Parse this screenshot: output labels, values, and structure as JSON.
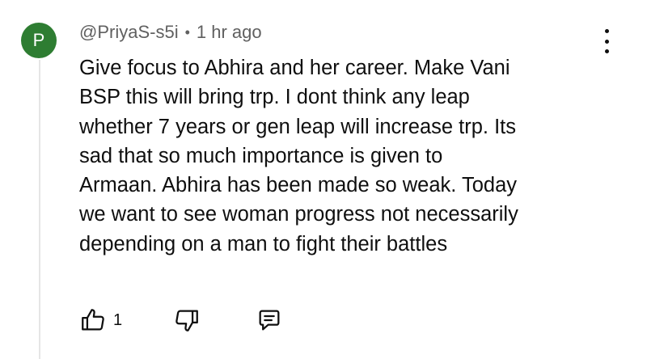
{
  "comment": {
    "avatar_letter": "P",
    "avatar_color": "#2e7d32",
    "author": "@PriyaS-s5i",
    "separator": "•",
    "timestamp": "1 hr ago",
    "text_lines": [
      "Give focus to Abhira and her career. Make Vani",
      "BSP this will bring trp. I dont think any leap",
      "whether 7 years or gen leap will increase trp. Its",
      "sad that so much importance is given to",
      "Armaan. Abhira has been made so weak. Today",
      "we want to see woman progress not necessarily",
      "depending on a man to fight their battles"
    ],
    "like_count": "1"
  },
  "icons": {
    "like": "thumbs-up-icon",
    "dislike": "thumbs-down-icon",
    "reply": "comment-reply-icon",
    "more": "more-vertical-icon"
  }
}
